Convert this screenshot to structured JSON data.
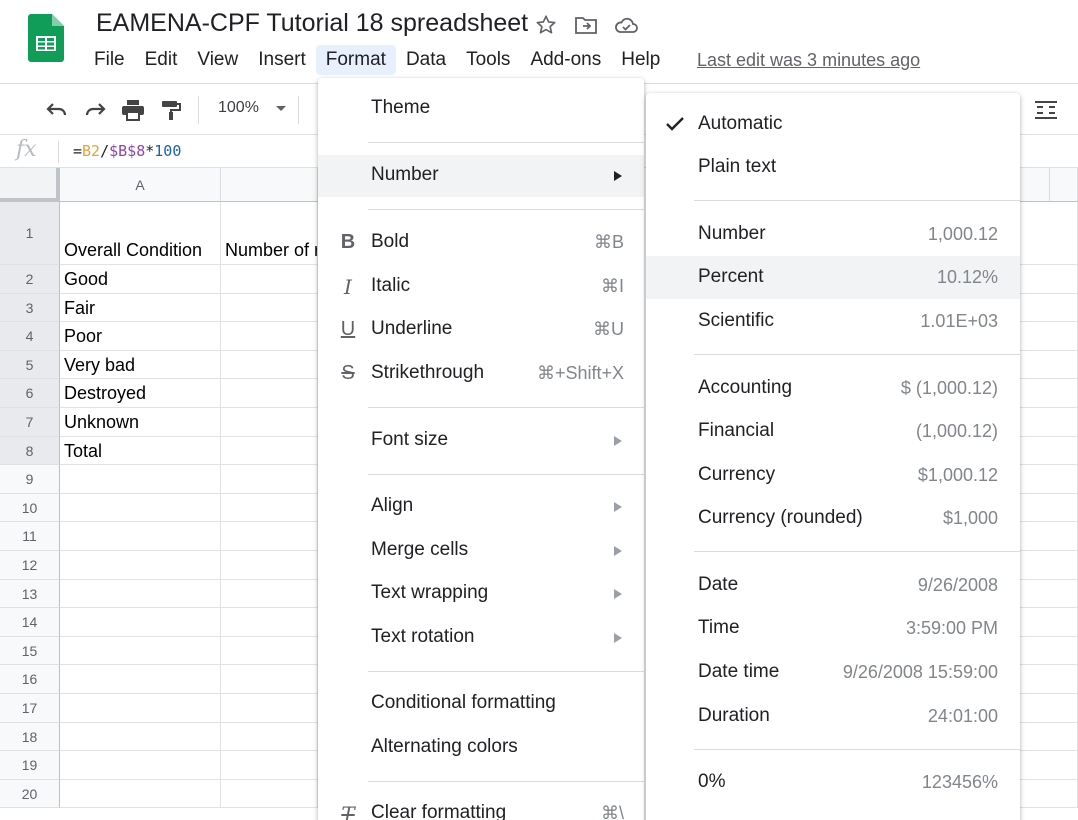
{
  "app": {
    "title": "EAMENA-CPF Tutorial 18 spreadsheet",
    "last_edit": "Last edit was 3 minutes ago",
    "menus": [
      "File",
      "Edit",
      "View",
      "Insert",
      "Format",
      "Data",
      "Tools",
      "Add-ons",
      "Help"
    ]
  },
  "toolbar": {
    "zoom": "100%"
  },
  "formula_bar": {
    "fx": "fx",
    "parts": [
      "=",
      "B2",
      "/",
      "$B$8",
      "*",
      "100"
    ]
  },
  "grid": {
    "columns": [
      "A"
    ],
    "rows": [
      "1",
      "2",
      "3",
      "4",
      "5",
      "6",
      "7",
      "8",
      "9",
      "10",
      "11",
      "12",
      "13",
      "14",
      "15",
      "16",
      "17",
      "18",
      "19",
      "20"
    ],
    "col_a": [
      "Overall Condition",
      "Good",
      "Fair",
      "Poor",
      "Very bad",
      "Destroyed",
      "Unknown",
      "Total"
    ],
    "b1": "Number of r"
  },
  "format_menu": {
    "theme": "Theme",
    "number": "Number",
    "bold": "Bold",
    "bold_sc": "⌘B",
    "italic": "Italic",
    "italic_sc": "⌘I",
    "underline": "Underline",
    "underline_sc": "⌘U",
    "strike": "Strikethrough",
    "strike_sc": "⌘+Shift+X",
    "font_size": "Font size",
    "align": "Align",
    "merge": "Merge cells",
    "wrap": "Text wrapping",
    "rotation": "Text rotation",
    "conditional": "Conditional formatting",
    "alternating": "Alternating colors",
    "clear": "Clear formatting",
    "clear_sc": "⌘\\"
  },
  "number_submenu": {
    "automatic": "Automatic",
    "plain_text": "Plain text",
    "number": "Number",
    "number_val": "1,000.12",
    "percent": "Percent",
    "percent_val": "10.12%",
    "scientific": "Scientific",
    "scientific_val": "1.01E+03",
    "accounting": "Accounting",
    "accounting_val": "$ (1,000.12)",
    "financial": "Financial",
    "financial_val": "(1,000.12)",
    "currency": "Currency",
    "currency_val": "$1,000.12",
    "currency_rounded": "Currency (rounded)",
    "currency_rounded_val": "$1,000",
    "date": "Date",
    "date_val": "9/26/2008",
    "time": "Time",
    "time_val": "3:59:00 PM",
    "datetime": "Date time",
    "datetime_val": "9/26/2008 15:59:00",
    "duration": "Duration",
    "duration_val": "24:01:00",
    "zero_pct": "0%",
    "zero_pct_val": "123456%"
  },
  "colors": {
    "sheets_green": "#0f9d58",
    "menu_active": "#e8f0fe",
    "hover": "#f1f3f4"
  }
}
